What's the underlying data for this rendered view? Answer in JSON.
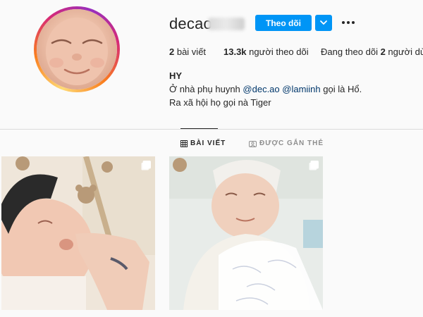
{
  "profile": {
    "username": "decao",
    "follow_label": "Theo dõi",
    "stats": {
      "posts_count": "2",
      "posts_label": " bài viết",
      "followers_count": "13.3k",
      "followers_label": " người theo dõi",
      "following_prefix": "Đang theo dõi ",
      "following_count": "2",
      "following_suffix": " người dùng"
    },
    "bio": {
      "name": "HY",
      "line1_prefix": "Ở nhà phụ huynh ",
      "mention1": "@dec.ao",
      "mention2": "@lamiinh",
      "line1_suffix": " gọi là Hổ.",
      "line2": "Ra xã hội họ gọi nà Tiger"
    }
  },
  "tabs": [
    {
      "label": "BÀI VIẾT",
      "icon": "grid-icon"
    },
    {
      "label": "ĐƯỢC GẮN THẺ",
      "icon": "tagged-icon"
    }
  ],
  "posts": [
    {
      "icon": "multiple-posts-icon"
    },
    {
      "icon": "multiple-posts-icon"
    }
  ],
  "colors": {
    "accent": "#0095f6",
    "background": "#fafafa",
    "mention": "#00376b",
    "text": "#262626",
    "muted": "#8e8e8e",
    "divider": "#dbdbdb"
  }
}
